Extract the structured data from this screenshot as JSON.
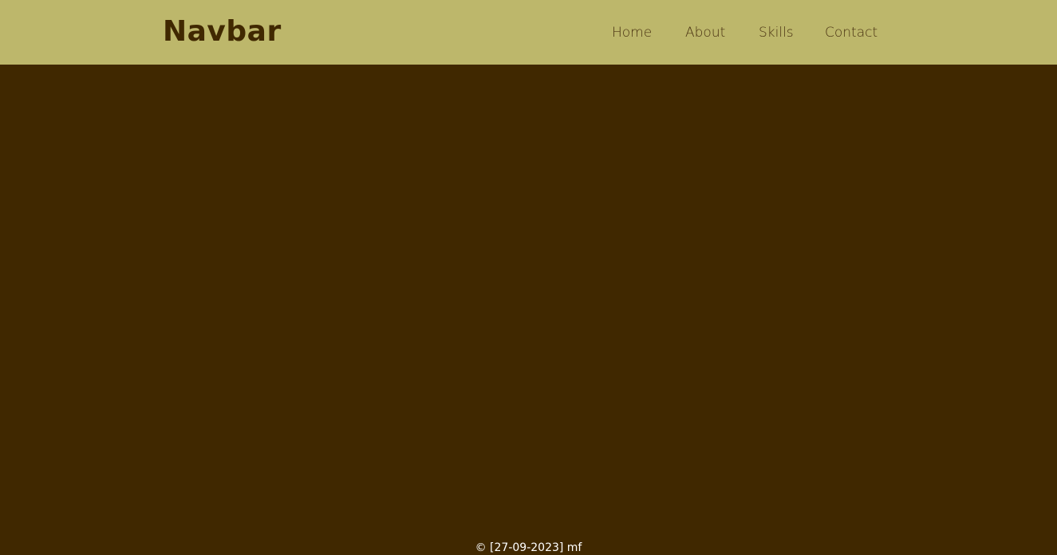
{
  "navbar": {
    "brand": "Navbar",
    "links": [
      {
        "label": "Home"
      },
      {
        "label": "About"
      },
      {
        "label": "Skills"
      },
      {
        "label": "Contact"
      }
    ]
  },
  "footer": {
    "text": "© [27-09-2023] mf"
  },
  "colors": {
    "navbar_background": "#BDB76B",
    "page_background": "#402800",
    "brand_text": "#402800",
    "footer_text": "#FFFFFF"
  }
}
